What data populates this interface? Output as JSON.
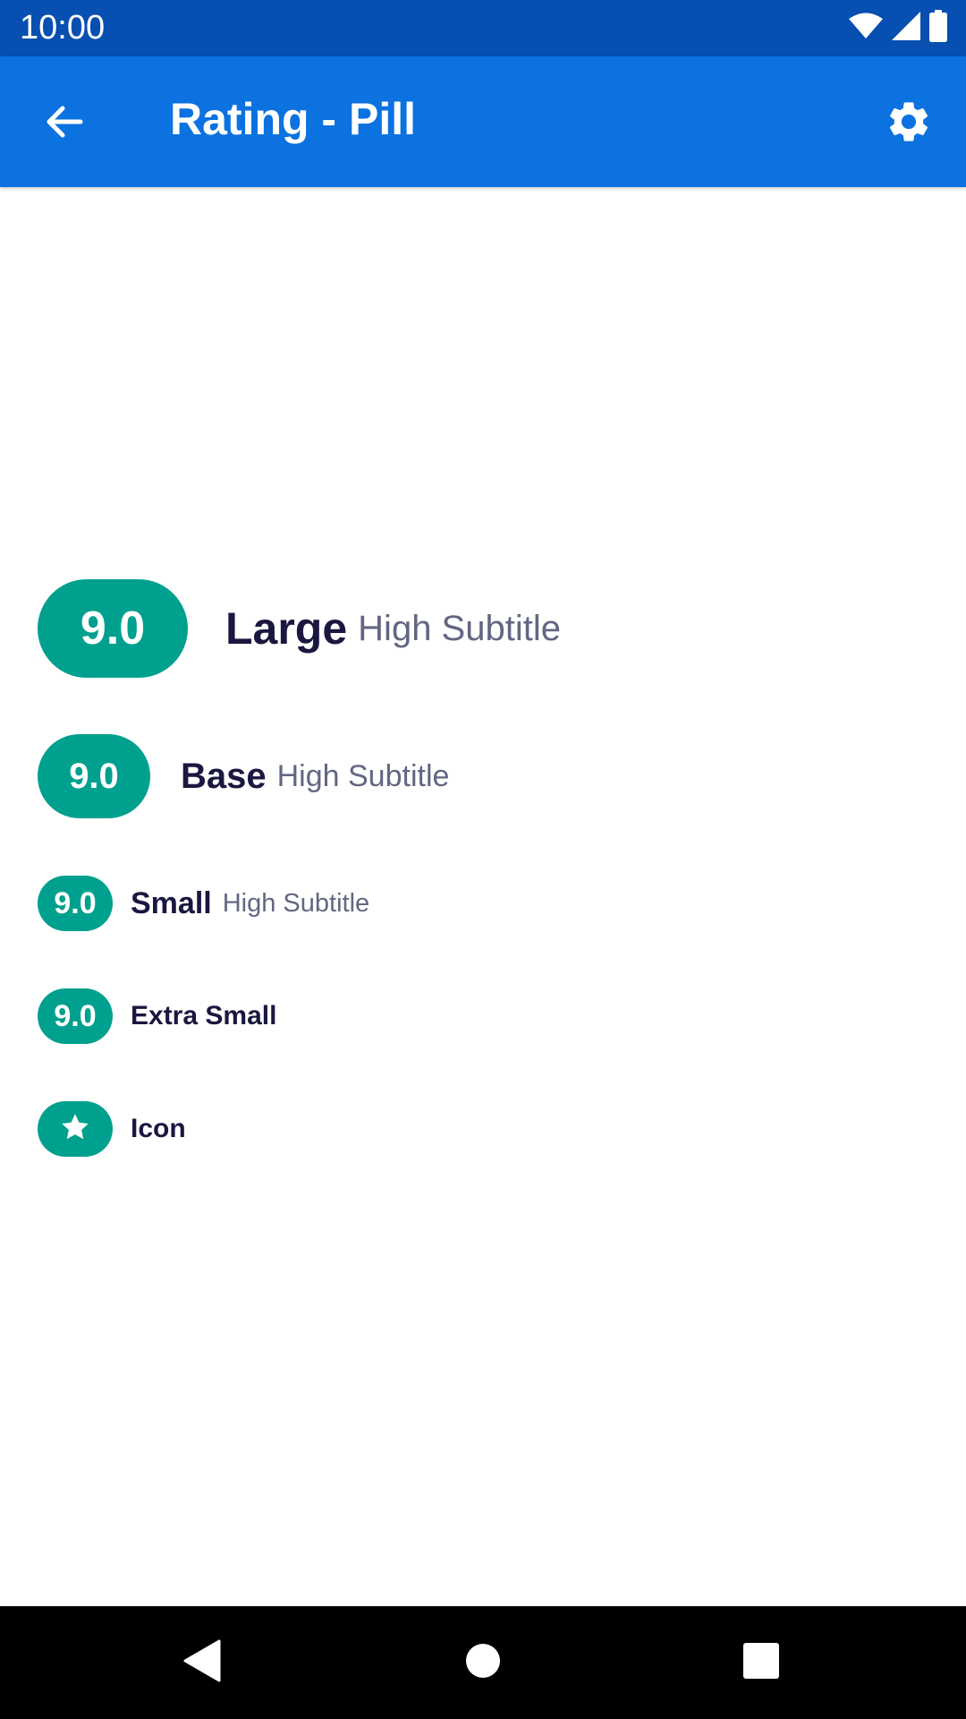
{
  "status_bar": {
    "time": "10:00",
    "icons": [
      "wifi-icon",
      "cell-signal-icon",
      "battery-icon"
    ]
  },
  "app_bar": {
    "title": "Rating - Pill",
    "back_icon": "arrow-back-icon",
    "settings_icon": "gear-icon",
    "background": "#0b72e0",
    "status_background": "#074fb0"
  },
  "ratings": {
    "accent": "#00a08e",
    "large": {
      "value": "9.0",
      "label": "Large",
      "subtitle": "High Subtitle"
    },
    "base": {
      "value": "9.0",
      "label": "Base",
      "subtitle": "High Subtitle"
    },
    "small": {
      "value": "9.0",
      "label": "Small",
      "subtitle": "High Subtitle"
    },
    "extra_small": {
      "value": "9.0",
      "label": "Extra Small"
    },
    "icon": {
      "icon": "star-icon",
      "label": "Icon"
    }
  },
  "nav_bar": {
    "back": "triangle-back-icon",
    "home": "circle-home-icon",
    "recents": "square-recents-icon"
  }
}
